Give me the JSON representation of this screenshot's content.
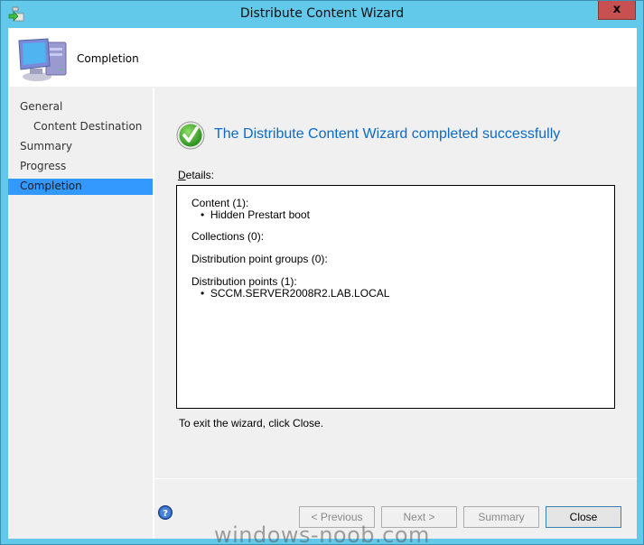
{
  "window": {
    "title": "Distribute Content Wizard",
    "close_glyph": "x"
  },
  "header": {
    "title": "Completion",
    "icon": "computer-icon"
  },
  "sidebar": {
    "items": [
      {
        "label": "General",
        "sub": false,
        "active": false
      },
      {
        "label": "Content Destination",
        "sub": true,
        "active": false
      },
      {
        "label": "Summary",
        "sub": false,
        "active": false
      },
      {
        "label": "Progress",
        "sub": false,
        "active": false
      },
      {
        "label": "Completion",
        "sub": false,
        "active": true
      }
    ]
  },
  "main": {
    "success_title": "The Distribute Content Wizard completed successfully",
    "details_label_accel": "D",
    "details_label_rest": "etails:",
    "details": {
      "content_heading": "Content (1):",
      "content_items": [
        "Hidden Prestart boot"
      ],
      "collections_heading": "Collections (0):",
      "dp_groups_heading": "Distribution point groups (0):",
      "dp_heading": "Distribution points (1):",
      "dp_items": [
        "SCCM.SERVER2008R2.LAB.LOCAL"
      ]
    },
    "exit_note": "To exit the wizard, click Close."
  },
  "buttons": {
    "previous": "< Previous",
    "next": "Next >",
    "summary": "Summary",
    "close": "Close"
  },
  "watermark": "windows-noob.com",
  "colors": {
    "titlebar": "#62c9eb",
    "accent_selected": "#3399ff",
    "success_text": "#0a6bc8",
    "close_button": "#c75050"
  }
}
